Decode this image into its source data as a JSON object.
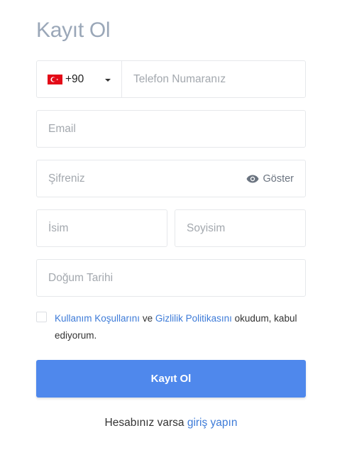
{
  "page": {
    "title": "Kayıt Ol"
  },
  "form": {
    "phone": {
      "country_flag": "turkey-flag",
      "dial_code": "+90",
      "placeholder": "Telefon Numaranız"
    },
    "email": {
      "placeholder": "Email"
    },
    "password": {
      "placeholder": "Şifreniz",
      "show_label": "Göster"
    },
    "first_name": {
      "placeholder": "İsim"
    },
    "last_name": {
      "placeholder": "Soyisim"
    },
    "birth_date": {
      "placeholder": "Doğum Tarihi"
    },
    "terms": {
      "checked": false,
      "terms_link": "Kullanım Koşullarını",
      "connector": "ve",
      "privacy_link": "Gizlilik Politikasını",
      "suffix": "okudum, kabul ediyorum."
    },
    "submit_label": "Kayıt Ol"
  },
  "footer": {
    "prefix": "Hesabınız varsa",
    "login_link": "giriş yapın"
  },
  "colors": {
    "title": "#9aa7b8",
    "accent": "#4f88ec",
    "link": "#3d7bd8",
    "border": "#e6e8eb",
    "placeholder": "#a3a8ae"
  }
}
